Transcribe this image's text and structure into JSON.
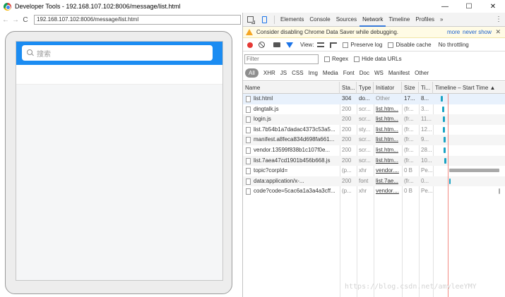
{
  "window": {
    "title": "Developer Tools - 192.168.107.102:8006/message/list.html",
    "controls": [
      "—",
      "☐",
      "✕"
    ]
  },
  "browser": {
    "back": "←",
    "forward": "→",
    "reload": "C",
    "url": "192.168.107.102:8006/message/list.html"
  },
  "app": {
    "search_placeholder": "搜索",
    "colors": {
      "header": "#1b8cf2",
      "background": "#f5f6f7"
    }
  },
  "devtools": {
    "tabs": [
      "Elements",
      "Console",
      "Sources",
      "Network",
      "Timeline",
      "Profiles"
    ],
    "more": "»",
    "active_tab": "Network",
    "warning": {
      "text": "Consider disabling Chrome Data Saver while debugging.",
      "more": "more",
      "never_show": "never show",
      "close": "✕"
    },
    "toolbar": {
      "view_label": "View:",
      "preserve_log": "Preserve log",
      "disable_cache": "Disable cache",
      "throttling": "No throttling"
    },
    "filter": {
      "placeholder": "Filter",
      "regex": "Regex",
      "hide_data_urls": "Hide data URLs"
    },
    "types": [
      "All",
      "XHR",
      "JS",
      "CSS",
      "Img",
      "Media",
      "Font",
      "Doc",
      "WS",
      "Manifest",
      "Other"
    ],
    "columns": [
      "Name",
      "Sta...",
      "Type",
      "Initiator",
      "Size",
      "Ti...",
      "Timeline – Start Time ▲"
    ],
    "rows": [
      {
        "name": "list.html",
        "status": "304",
        "type": "do...",
        "initiator": "Other",
        "size": "17...",
        "time": "8..."
      },
      {
        "name": "dingtalk.js",
        "status": "200",
        "type": "scr...",
        "initiator": "list.htm...",
        "size": "(fr...",
        "time": "3..."
      },
      {
        "name": "login.js",
        "status": "200",
        "type": "scr...",
        "initiator": "list.htm...",
        "size": "(fr...",
        "time": "11..."
      },
      {
        "name": "list.7b54b1a7dadac4373c53a5...",
        "status": "200",
        "type": "sty...",
        "initiator": "list.htm...",
        "size": "(fr...",
        "time": "12..."
      },
      {
        "name": "manifest.a8feca834d698fa661...",
        "status": "200",
        "type": "scr...",
        "initiator": "list.htm...",
        "size": "(fr...",
        "time": "9..."
      },
      {
        "name": "vendor.13599f838b1c107f0e...",
        "status": "200",
        "type": "scr...",
        "initiator": "list.htm...",
        "size": "(fr...",
        "time": "28..."
      },
      {
        "name": "list.7aea47cd1901b456b668.js",
        "status": "200",
        "type": "scr...",
        "initiator": "list.htm...",
        "size": "(fr...",
        "time": "10..."
      },
      {
        "name": "topic?corpId=",
        "status": "(p...",
        "type": "xhr",
        "initiator": "vendor....",
        "size": "0 B",
        "time": "Pe..."
      },
      {
        "name": "data:application/x-...",
        "status": "200",
        "type": "font",
        "initiator": "list.7ae...",
        "size": "(fr...",
        "time": "0..."
      },
      {
        "name": "code?code=5cac6a1a3a4a3cff...",
        "status": "(p...",
        "type": "xhr",
        "initiator": "vendor....",
        "size": "0 B",
        "time": "Pe..."
      }
    ]
  },
  "watermark": "https://blog.csdn.net/amyleeYMY"
}
